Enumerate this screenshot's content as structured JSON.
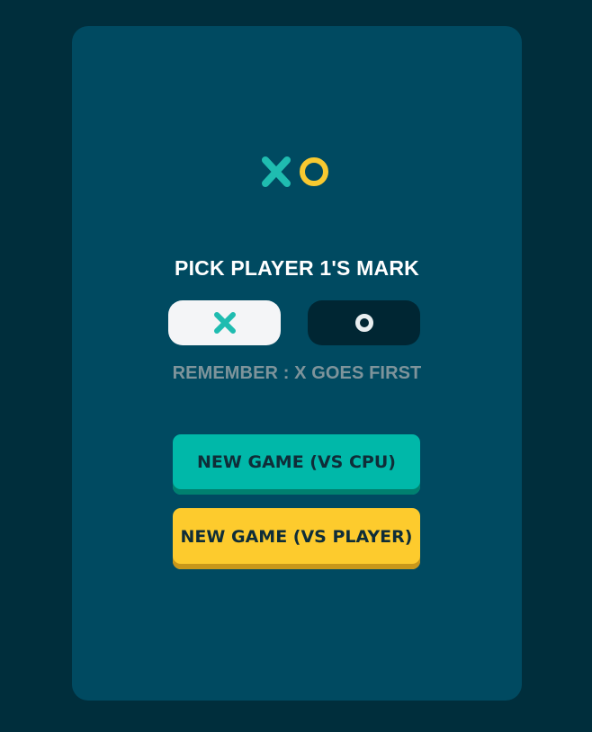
{
  "logo": {
    "x_icon": "x-mark-icon",
    "o_icon": "o-mark-icon",
    "x_color": "#1fbcb0",
    "o_color": "#f8c930"
  },
  "picker": {
    "title": "PICK PLAYER 1'S MARK",
    "options": [
      {
        "mark": "X",
        "icon": "x-mark-icon",
        "selected": true,
        "color": "#1fbcb0"
      },
      {
        "mark": "O",
        "icon": "o-mark-icon",
        "selected": false,
        "color": "#e8eef0"
      }
    ],
    "hint": "REMEMBER : X GOES FIRST"
  },
  "buttons": {
    "vs_cpu": "NEW GAME (VS CPU)",
    "vs_player": "NEW GAME (VS PLAYER)"
  },
  "colors": {
    "background": "#002e3c",
    "card": "#004a61",
    "teal": "#00b8a9",
    "yellow": "#fdcb2d"
  }
}
